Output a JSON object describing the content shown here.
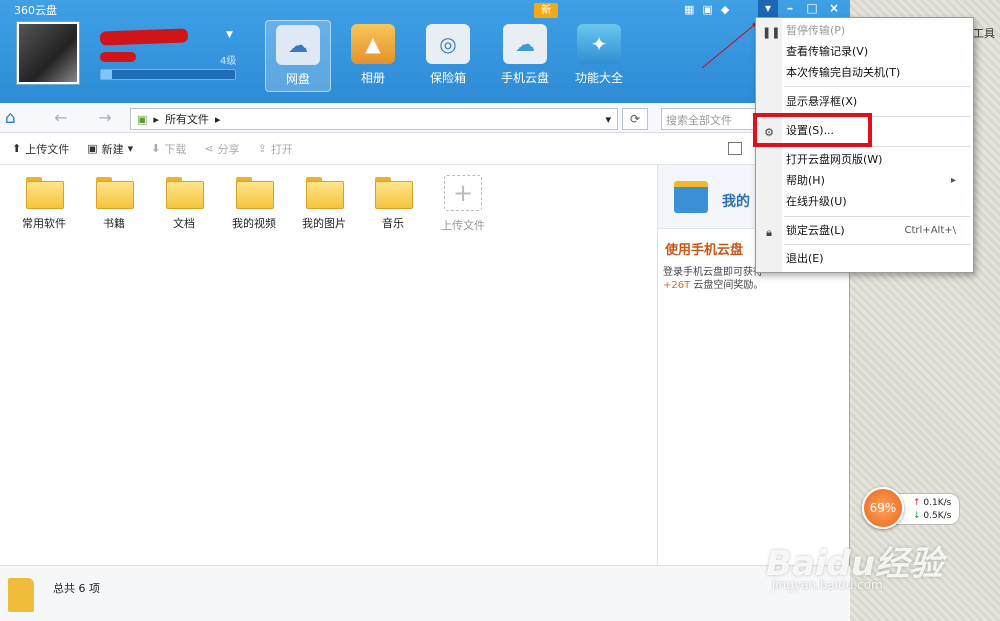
{
  "app": {
    "title": "360云盘"
  },
  "user": {
    "level": "4级",
    "quota_fraction": 0.08
  },
  "nav": [
    {
      "label": "网盘",
      "icon": "cloud-drive-icon"
    },
    {
      "label": "相册",
      "icon": "photo-album-icon"
    },
    {
      "label": "保险箱",
      "icon": "safe-box-icon"
    },
    {
      "label": "手机云盘",
      "icon": "mobile-cloud-icon"
    },
    {
      "label": "功能大全",
      "icon": "toolbox-icon"
    }
  ],
  "new_badge": "新",
  "window_controls": {
    "menu": "▾",
    "minimize": "–",
    "maximize": "□",
    "close": "×"
  },
  "addressbar": {
    "path": "所有文件",
    "search_placeholder": "搜索全部文件"
  },
  "actions": {
    "upload": "上传文件",
    "new": "新建",
    "download": "下载",
    "share": "分享",
    "open": "打开"
  },
  "files": [
    {
      "name": "常用软件"
    },
    {
      "name": "书籍"
    },
    {
      "name": "文档"
    },
    {
      "name": "我的视频"
    },
    {
      "name": "我的图片"
    },
    {
      "name": "音乐"
    }
  ],
  "upload_tile": "上传文件",
  "side": {
    "title": "我的",
    "heading": "使用手机云盘",
    "text1": "登录手机云盘即可获得",
    "highlight": "+26T",
    "text2": " 云盘空间奖励。"
  },
  "status": {
    "total": "总共 6 项"
  },
  "menu": {
    "pause": "暂停传输(P)",
    "history": "查看传输记录(V)",
    "shutdown": "本次传输完自动关机(T)",
    "float": "显示悬浮框(X)",
    "settings": "设置(S)...",
    "web": "打开云盘网页版(W)",
    "help": "帮助(H)",
    "upgrade": "在线升级(U)",
    "lock": "锁定云盘(L)",
    "lock_shortcut": "Ctrl+Alt+\\",
    "exit": "退出(E)"
  },
  "speed": {
    "percent": "69%",
    "up": "0.1K/s",
    "down": "0.5K/s"
  },
  "desktop_label": "工具",
  "watermark": {
    "main": "Baidu经验",
    "sub": "jingyan.baidu.com"
  },
  "colors": {
    "header": "#2e8bd6",
    "highlight": "#e0101b",
    "accent_orange": "#e06d1a"
  }
}
